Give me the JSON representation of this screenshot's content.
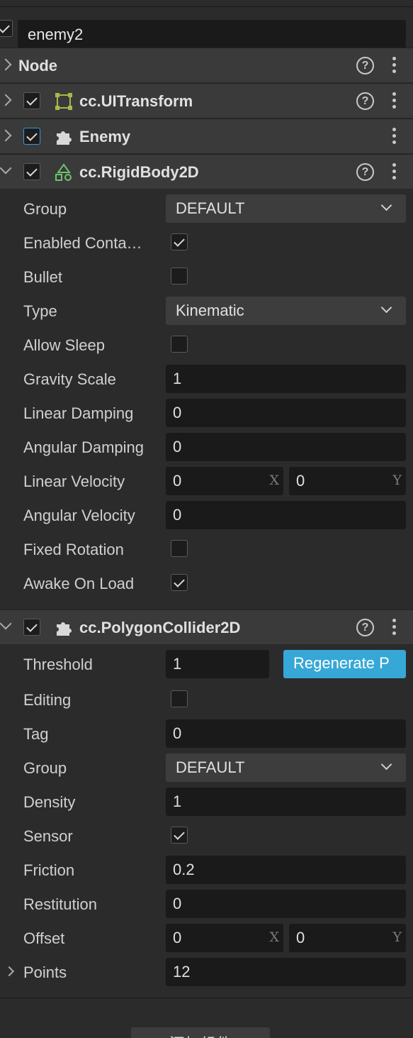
{
  "node": {
    "name": "enemy2",
    "enabled": true
  },
  "components": {
    "node": {
      "title": "Node",
      "help": "?"
    },
    "uitransform": {
      "title": "cc.UITransform",
      "help": "?"
    },
    "enemy": {
      "title": "Enemy"
    },
    "rigidbody": {
      "title": "cc.RigidBody2D",
      "help": "?"
    },
    "polygon": {
      "title": "cc.PolygonCollider2D",
      "help": "?"
    }
  },
  "rigidbody_props": {
    "group_label": "Group",
    "group_value": "DEFAULT",
    "enabled_contact_label": "Enabled Conta…",
    "enabled_contact": true,
    "bullet_label": "Bullet",
    "bullet": false,
    "type_label": "Type",
    "type_value": "Kinematic",
    "allow_sleep_label": "Allow Sleep",
    "allow_sleep": false,
    "gravity_scale_label": "Gravity Scale",
    "gravity_scale": "1",
    "linear_damping_label": "Linear Damping",
    "linear_damping": "0",
    "angular_damping_label": "Angular Damping",
    "angular_damping": "0",
    "linear_velocity_label": "Linear Velocity",
    "linear_velocity_x": "0",
    "linear_velocity_y": "0",
    "angular_velocity_label": "Angular Velocity",
    "angular_velocity": "0",
    "fixed_rotation_label": "Fixed Rotation",
    "fixed_rotation": false,
    "awake_on_load_label": "Awake On Load",
    "awake_on_load": true
  },
  "polygon_props": {
    "threshold_label": "Threshold",
    "threshold": "1",
    "regenerate_label": "Regenerate P",
    "editing_label": "Editing",
    "editing": false,
    "tag_label": "Tag",
    "tag": "0",
    "group_label": "Group",
    "group_value": "DEFAULT",
    "density_label": "Density",
    "density": "1",
    "sensor_label": "Sensor",
    "sensor": true,
    "friction_label": "Friction",
    "friction": "0.2",
    "restitution_label": "Restitution",
    "restitution": "0",
    "offset_label": "Offset",
    "offset_x": "0",
    "offset_y": "0",
    "points_label": "Points",
    "points": "12"
  },
  "axis": {
    "x": "X",
    "y": "Y"
  },
  "footer": {
    "add_component_label": "添加组件"
  },
  "colors": {
    "accent": "#36a7d6",
    "panel": "#2b2b2b",
    "header": "#3a3a3a",
    "field": "#1a1a1a"
  },
  "icons": [
    "chevron-right-icon",
    "chevron-down-icon",
    "help-icon",
    "more-icon",
    "uitransform-icon",
    "puzzle-icon",
    "rigidbody-icon",
    "checkbox-icon"
  ]
}
